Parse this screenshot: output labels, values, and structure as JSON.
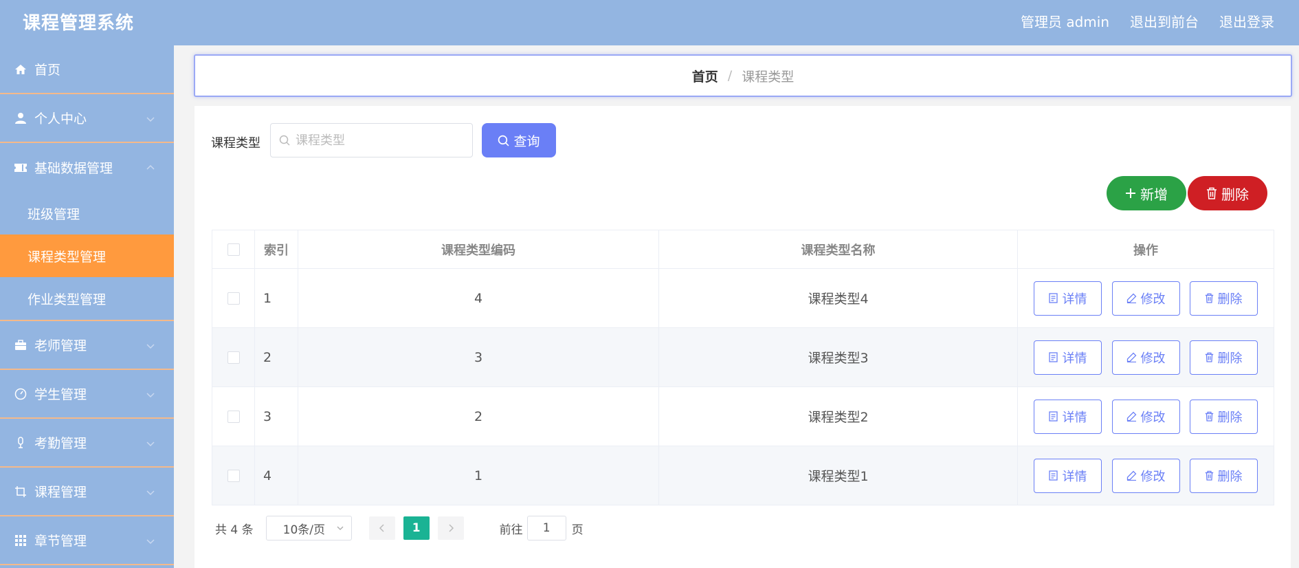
{
  "header": {
    "brand": "课程管理系统",
    "admin_label": "管理员 admin",
    "to_front": "退出到前台",
    "logout": "退出登录"
  },
  "sidebar": {
    "items": [
      {
        "label": "首页",
        "icon": "home-icon"
      },
      {
        "label": "个人中心",
        "icon": "user-icon"
      },
      {
        "label": "基础数据管理",
        "icon": "ticket-icon"
      },
      {
        "label": "老师管理",
        "icon": "briefcase-icon"
      },
      {
        "label": "学生管理",
        "icon": "gauge-icon"
      },
      {
        "label": "考勤管理",
        "icon": "microphone-icon"
      },
      {
        "label": "课程管理",
        "icon": "crop-icon"
      },
      {
        "label": "章节管理",
        "icon": "grid-icon"
      }
    ],
    "sub_items": [
      "班级管理",
      "课程类型管理",
      "作业类型管理"
    ]
  },
  "breadcrumb": {
    "home": "首页",
    "separator": "/",
    "current": "课程类型"
  },
  "search": {
    "label": "课程类型",
    "placeholder": "课程类型",
    "value": "",
    "query_label": "查询"
  },
  "toolbar": {
    "add_label": "新增",
    "delete_label": "删除"
  },
  "table": {
    "headers": {
      "index": "索引",
      "code": "课程类型编码",
      "name": "课程类型名称",
      "ops": "操作"
    },
    "rows": [
      {
        "index": "1",
        "code": "4",
        "name": "课程类型4"
      },
      {
        "index": "2",
        "code": "3",
        "name": "课程类型3"
      },
      {
        "index": "3",
        "code": "2",
        "name": "课程类型2"
      },
      {
        "index": "4",
        "code": "1",
        "name": "课程类型1"
      }
    ],
    "ops": {
      "detail": "详情",
      "edit": "修改",
      "delete": "删除"
    }
  },
  "pagination": {
    "total": "共 4 条",
    "page_size": "10条/页",
    "current_page": "1",
    "goto_prefix": "前往",
    "goto_value": "1",
    "goto_suffix": "页"
  },
  "colors": {
    "header_bg": "#93b5e1",
    "active_menu": "#ff9a3e",
    "primary": "#6a7ff6",
    "add": "#2ba246",
    "delete": "#cf1f24",
    "page_active": "#1ab394"
  }
}
